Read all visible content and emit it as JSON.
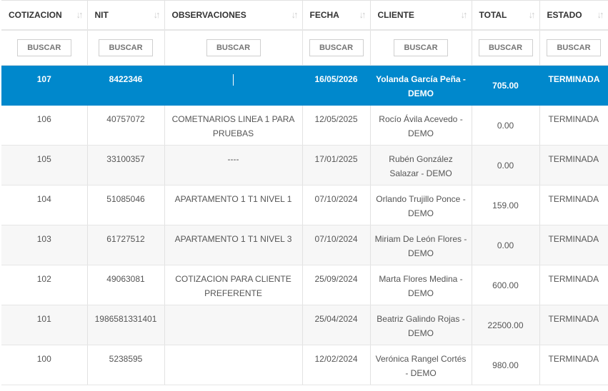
{
  "table": {
    "headers": [
      "COTIZACION",
      "NIT",
      "OBSERVACIONES",
      "FECHA",
      "CLIENTE",
      "TOTAL",
      "ESTADO"
    ],
    "filter_placeholder": "BUSCAR",
    "rows": [
      {
        "cotizacion": "107",
        "nit": "8422346",
        "observaciones": "",
        "fecha": "16/05/2026",
        "cliente": "Yolanda García Peña - DEMO",
        "total": "705.00",
        "estado": "TERMINADA"
      },
      {
        "cotizacion": "106",
        "nit": "40757072",
        "observaciones": "COMETNARIOS LINEA 1 PARA PRUEBAS",
        "fecha": "12/05/2025",
        "cliente": "Rocío Ávila Acevedo - DEMO",
        "total": "0.00",
        "estado": "TERMINADA"
      },
      {
        "cotizacion": "105",
        "nit": "33100357",
        "observaciones": "----",
        "fecha": "17/01/2025",
        "cliente": "Rubén González Salazar - DEMO",
        "total": "0.00",
        "estado": "TERMINADA"
      },
      {
        "cotizacion": "104",
        "nit": "51085046",
        "observaciones": "APARTAMENTO 1 T1 NIVEL 1",
        "fecha": "07/10/2024",
        "cliente": "Orlando Trujillo Ponce - DEMO",
        "total": "159.00",
        "estado": "TERMINADA"
      },
      {
        "cotizacion": "103",
        "nit": "61727512",
        "observaciones": "APARTAMENTO 1 T1 NIVEL 3",
        "fecha": "07/10/2024",
        "cliente": "Miriam De León Flores - DEMO",
        "total": "0.00",
        "estado": "TERMINADA"
      },
      {
        "cotizacion": "102",
        "nit": "49063081",
        "observaciones": "COTIZACION PARA CLIENTE PREFERENTE",
        "fecha": "25/09/2024",
        "cliente": "Marta Flores Medina - DEMO",
        "total": "600.00",
        "estado": "TERMINADA"
      },
      {
        "cotizacion": "101",
        "nit": "1986581331401",
        "observaciones": "",
        "fecha": "25/04/2024",
        "cliente": "Beatriz Galindo Rojas - DEMO",
        "total": "22500.00",
        "estado": "TERMINADA"
      },
      {
        "cotizacion": "100",
        "nit": "5238595",
        "observaciones": "",
        "fecha": "12/02/2024",
        "cliente": "Verónica Rangel Cortés - DEMO",
        "total": "980.00",
        "estado": "TERMINADA"
      }
    ],
    "selected_row": 0
  },
  "colors": {
    "selected_bg": "#0088cc",
    "stripe_bg": "#f7f7f7",
    "header_text": "#333333",
    "sort_icon": "#cfcfcf"
  },
  "icons": {
    "sort": "sort-arrows-icon"
  }
}
